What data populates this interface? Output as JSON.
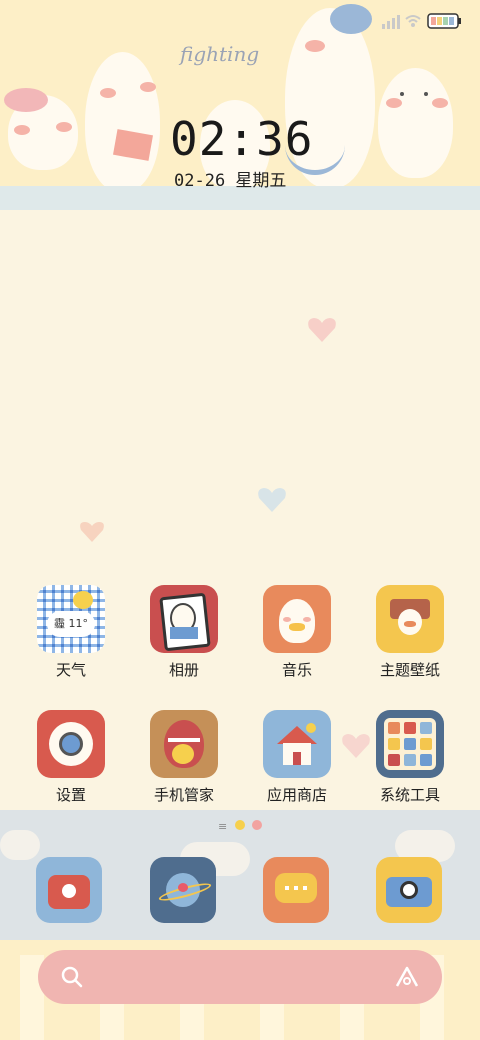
{
  "status": {
    "signal_icon": "signal-icon",
    "wifi_icon": "wifi-icon",
    "battery_icon": "battery-icon"
  },
  "widget": {
    "title_art": "fighting",
    "time": "02:36",
    "date": "02-26  星期五"
  },
  "apps": [
    {
      "label": "天气",
      "badge": "霾 11°"
    },
    {
      "label": "相册"
    },
    {
      "label": "音乐"
    },
    {
      "label": "主题壁纸"
    },
    {
      "label": "设置"
    },
    {
      "label": "手机管家"
    },
    {
      "label": "应用商店"
    },
    {
      "label": "系统工具"
    }
  ],
  "dock": {
    "page_indicator": "≡",
    "items": [
      "phone-icon",
      "browser-icon",
      "messages-icon",
      "camera-icon"
    ]
  },
  "search": {
    "search_icon": "search-icon",
    "assistant_icon": "assistant-icon"
  },
  "colors": {
    "background": "#fbf4e1",
    "header": "#fdefc7",
    "dock": "#dde3e6",
    "search_bar": "#f0b5b1"
  }
}
